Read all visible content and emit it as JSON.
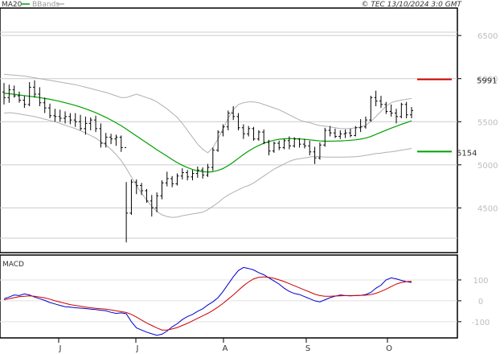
{
  "header": {
    "legend": [
      {
        "label": "MA20",
        "color": "#00a000"
      },
      {
        "label": "BBands",
        "color": "#b0b0b0"
      }
    ],
    "copyright": "© TEC 13/10/2024 3:0 GMT"
  },
  "chart_data": [
    {
      "type": "candlestick",
      "x_labels": [
        "J",
        "J",
        "A",
        "S",
        "O"
      ],
      "ylim": [
        4000,
        6800
      ],
      "y_ticks": [
        4500,
        5000,
        5500,
        6000,
        6500
      ],
      "grid": true,
      "colors": {
        "bars": "#000000",
        "ma": "#00a000",
        "bbands": "#b0b0b0",
        "resistance": "#cc0000",
        "support": "#00a000"
      },
      "resistance": {
        "value": 5991,
        "label": "5991"
      },
      "support": {
        "value": 5154,
        "label": "5154"
      },
      "bars": [
        [
          5845,
          5950,
          5700,
          5780
        ],
        [
          5780,
          5930,
          5720,
          5870
        ],
        [
          5870,
          5920,
          5780,
          5800
        ],
        [
          5800,
          5850,
          5720,
          5750
        ],
        [
          5750,
          5800,
          5660,
          5700
        ],
        [
          5700,
          5960,
          5680,
          5900
        ],
        [
          5900,
          5980,
          5780,
          5820
        ],
        [
          5820,
          5900,
          5680,
          5720
        ],
        [
          5720,
          5780,
          5600,
          5660
        ],
        [
          5660,
          5710,
          5540,
          5570
        ],
        [
          5570,
          5650,
          5500,
          5560
        ],
        [
          5560,
          5640,
          5500,
          5540
        ],
        [
          5540,
          5620,
          5480,
          5560
        ],
        [
          5560,
          5600,
          5470,
          5520
        ],
        [
          5520,
          5600,
          5440,
          5500
        ],
        [
          5500,
          5580,
          5400,
          5420
        ],
        [
          5420,
          5560,
          5350,
          5480
        ],
        [
          5480,
          5550,
          5400,
          5520
        ],
        [
          5520,
          5570,
          5380,
          5420
        ],
        [
          5420,
          5480,
          5200,
          5250
        ],
        [
          5250,
          5370,
          5200,
          5320
        ],
        [
          5320,
          5360,
          5240,
          5300
        ],
        [
          5300,
          5350,
          5220,
          5320
        ],
        [
          5320,
          5340,
          5150,
          5200
        ],
        [
          5200,
          4800,
          4100,
          4440
        ],
        [
          4440,
          4830,
          4420,
          4800
        ],
        [
          4800,
          4830,
          4660,
          4760
        ],
        [
          4760,
          4790,
          4650,
          4700
        ],
        [
          4700,
          4720,
          4560,
          4580
        ],
        [
          4580,
          4650,
          4400,
          4500
        ],
        [
          4500,
          4680,
          4450,
          4640
        ],
        [
          4640,
          4820,
          4600,
          4790
        ],
        [
          4790,
          4920,
          4750,
          4840
        ],
        [
          4840,
          4870,
          4740,
          4780
        ],
        [
          4780,
          4900,
          4760,
          4870
        ],
        [
          4870,
          4960,
          4830,
          4910
        ],
        [
          4910,
          4940,
          4820,
          4860
        ],
        [
          4860,
          4940,
          4820,
          4900
        ],
        [
          4900,
          4980,
          4850,
          4940
        ],
        [
          4940,
          4970,
          4840,
          4880
        ],
        [
          4880,
          5010,
          4860,
          4970
        ],
        [
          4970,
          5200,
          4930,
          5170
        ],
        [
          5170,
          5400,
          5150,
          5380
        ],
        [
          5380,
          5470,
          5330,
          5440
        ],
        [
          5440,
          5630,
          5400,
          5600
        ],
        [
          5600,
          5680,
          5520,
          5560
        ],
        [
          5560,
          5600,
          5400,
          5430
        ],
        [
          5430,
          5470,
          5300,
          5360
        ],
        [
          5360,
          5450,
          5330,
          5420
        ],
        [
          5420,
          5440,
          5280,
          5300
        ],
        [
          5300,
          5400,
          5280,
          5380
        ],
        [
          5380,
          5410,
          5240,
          5260
        ],
        [
          5260,
          5290,
          5110,
          5160
        ],
        [
          5160,
          5270,
          5140,
          5250
        ],
        [
          5250,
          5280,
          5170,
          5200
        ],
        [
          5200,
          5300,
          5180,
          5280
        ],
        [
          5280,
          5330,
          5180,
          5220
        ],
        [
          5220,
          5320,
          5200,
          5300
        ],
        [
          5300,
          5310,
          5200,
          5240
        ],
        [
          5240,
          5300,
          5190,
          5220
        ],
        [
          5220,
          5280,
          5110,
          5150
        ],
        [
          5150,
          5210,
          5010,
          5080
        ],
        [
          5080,
          5260,
          5060,
          5230
        ],
        [
          5230,
          5430,
          5210,
          5400
        ],
        [
          5400,
          5450,
          5330,
          5370
        ],
        [
          5370,
          5420,
          5310,
          5330
        ],
        [
          5330,
          5400,
          5300,
          5360
        ],
        [
          5360,
          5410,
          5310,
          5370
        ],
        [
          5370,
          5420,
          5320,
          5340
        ],
        [
          5340,
          5450,
          5330,
          5430
        ],
        [
          5430,
          5530,
          5380,
          5440
        ],
        [
          5440,
          5560,
          5420,
          5520
        ],
        [
          5520,
          5800,
          5500,
          5780
        ],
        [
          5780,
          5860,
          5680,
          5740
        ],
        [
          5740,
          5800,
          5660,
          5700
        ],
        [
          5700,
          5730,
          5590,
          5620
        ],
        [
          5620,
          5700,
          5560,
          5600
        ],
        [
          5600,
          5650,
          5480,
          5560
        ],
        [
          5560,
          5720,
          5540,
          5700
        ],
        [
          5700,
          5730,
          5540,
          5580
        ],
        [
          5580,
          5670,
          5540,
          5630
        ]
      ],
      "ma20": [
        5830,
        5825,
        5818,
        5810,
        5803,
        5795,
        5788,
        5780,
        5770,
        5760,
        5748,
        5735,
        5720,
        5705,
        5688,
        5670,
        5650,
        5628,
        5604,
        5578,
        5550,
        5520,
        5488,
        5454,
        5415,
        5375,
        5335,
        5295,
        5255,
        5215,
        5175,
        5138,
        5100,
        5062,
        5026,
        4995,
        4968,
        4946,
        4930,
        4920,
        4916,
        4920,
        4935,
        4958,
        4990,
        5030,
        5075,
        5120,
        5160,
        5195,
        5225,
        5250,
        5270,
        5285,
        5296,
        5302,
        5305,
        5303,
        5300,
        5296,
        5290,
        5283,
        5277,
        5274,
        5274,
        5276,
        5278,
        5281,
        5285,
        5290,
        5298,
        5310,
        5328,
        5352,
        5378,
        5402,
        5425,
        5448,
        5470,
        5490,
        5510
      ],
      "bb_upper": [
        6050,
        6045,
        6040,
        6035,
        6030,
        6020,
        6010,
        6000,
        5990,
        5980,
        5970,
        5960,
        5950,
        5940,
        5930,
        5915,
        5900,
        5885,
        5870,
        5855,
        5840,
        5820,
        5800,
        5780,
        5780,
        5800,
        5820,
        5800,
        5780,
        5760,
        5730,
        5690,
        5650,
        5600,
        5550,
        5480,
        5400,
        5320,
        5240,
        5180,
        5140,
        5200,
        5300,
        5420,
        5540,
        5640,
        5700,
        5720,
        5730,
        5730,
        5720,
        5700,
        5680,
        5660,
        5640,
        5610,
        5580,
        5550,
        5520,
        5500,
        5490,
        5470,
        5455,
        5450,
        5440,
        5430,
        5420,
        5420,
        5420,
        5430,
        5440,
        5460,
        5500,
        5560,
        5620,
        5680,
        5720,
        5740,
        5750,
        5760,
        5770
      ],
      "bb_lower": [
        5600,
        5605,
        5600,
        5590,
        5580,
        5570,
        5560,
        5545,
        5530,
        5515,
        5500,
        5480,
        5460,
        5440,
        5420,
        5395,
        5370,
        5340,
        5310,
        5270,
        5230,
        5180,
        5120,
        5050,
        4960,
        4860,
        4760,
        4670,
        4590,
        4520,
        4460,
        4420,
        4400,
        4390,
        4395,
        4410,
        4420,
        4430,
        4440,
        4450,
        4480,
        4520,
        4560,
        4610,
        4650,
        4680,
        4710,
        4740,
        4760,
        4790,
        4830,
        4870,
        4910,
        4950,
        4980,
        5010,
        5040,
        5060,
        5070,
        5080,
        5090,
        5100,
        5095,
        5090,
        5090,
        5090,
        5090,
        5090,
        5092,
        5095,
        5100,
        5110,
        5120,
        5130,
        5135,
        5145,
        5150,
        5160,
        5170,
        5180,
        5190
      ]
    },
    {
      "type": "line",
      "title": "MACD",
      "ylim": [
        -170,
        200
      ],
      "y_ticks": [
        100,
        0,
        -100
      ],
      "series": [
        {
          "color": "#0000cc",
          "values": [
            10,
            18,
            28,
            25,
            33,
            28,
            18,
            10,
            2,
            -8,
            -15,
            -22,
            -28,
            -30,
            -33,
            -35,
            -37,
            -40,
            -42,
            -45,
            -48,
            -55,
            -60,
            -58,
            -62,
            -100,
            -130,
            -140,
            -150,
            -158,
            -165,
            -160,
            -145,
            -125,
            -110,
            -90,
            -75,
            -65,
            -50,
            -38,
            -20,
            -5,
            15,
            45,
            80,
            115,
            145,
            160,
            155,
            148,
            135,
            125,
            110,
            95,
            80,
            60,
            45,
            35,
            30,
            20,
            10,
            0,
            -5,
            5,
            15,
            22,
            28,
            25,
            24,
            25,
            26,
            30,
            40,
            60,
            75,
            100,
            110,
            105,
            98,
            92,
            88
          ]
        },
        {
          "color": "#cc0000",
          "values": [
            5,
            10,
            15,
            20,
            22,
            24,
            22,
            18,
            14,
            8,
            0,
            -6,
            -12,
            -18,
            -22,
            -26,
            -30,
            -33,
            -36,
            -38,
            -40,
            -44,
            -48,
            -52,
            -56,
            -65,
            -78,
            -92,
            -106,
            -118,
            -130,
            -140,
            -140,
            -135,
            -128,
            -118,
            -108,
            -96,
            -84,
            -72,
            -60,
            -46,
            -30,
            -12,
            8,
            28,
            50,
            72,
            90,
            105,
            112,
            115,
            112,
            108,
            100,
            92,
            82,
            72,
            62,
            52,
            42,
            32,
            25,
            22,
            22,
            23,
            24,
            25,
            25,
            25,
            26,
            27,
            30,
            36,
            45,
            56,
            68,
            80,
            88,
            92,
            93
          ]
        }
      ]
    }
  ]
}
